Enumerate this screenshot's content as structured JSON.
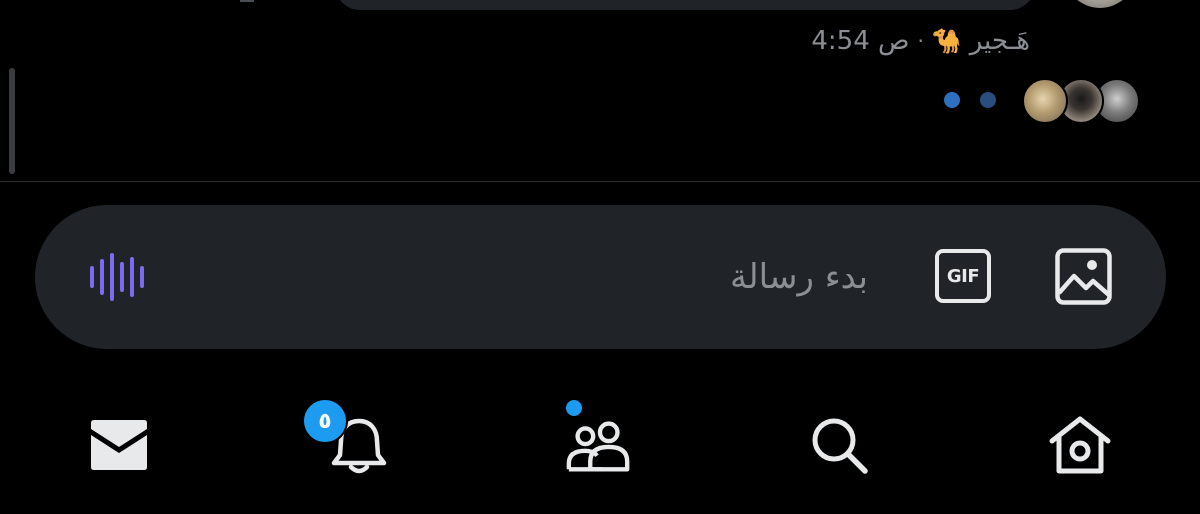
{
  "message": {
    "sender_name": "هَـجير",
    "sender_emoji": "🐪",
    "separator": "·",
    "timestamp": "4:54 ص",
    "typing_indicator_color": "#2f6fbf"
  },
  "composer": {
    "placeholder": "بدء رسالة",
    "gif_label": "GIF",
    "voice_icon": "voice-wave-icon",
    "image_icon": "image-icon",
    "accent_color": "#7c6bf0"
  },
  "bottom_nav": {
    "items": [
      {
        "icon": "mail-icon",
        "active": true
      },
      {
        "icon": "bell-icon",
        "badge": "٥"
      },
      {
        "icon": "communities-icon",
        "has_dot": true
      },
      {
        "icon": "search-icon"
      },
      {
        "icon": "home-icon"
      }
    ],
    "badge_color": "#1d9bf0"
  }
}
